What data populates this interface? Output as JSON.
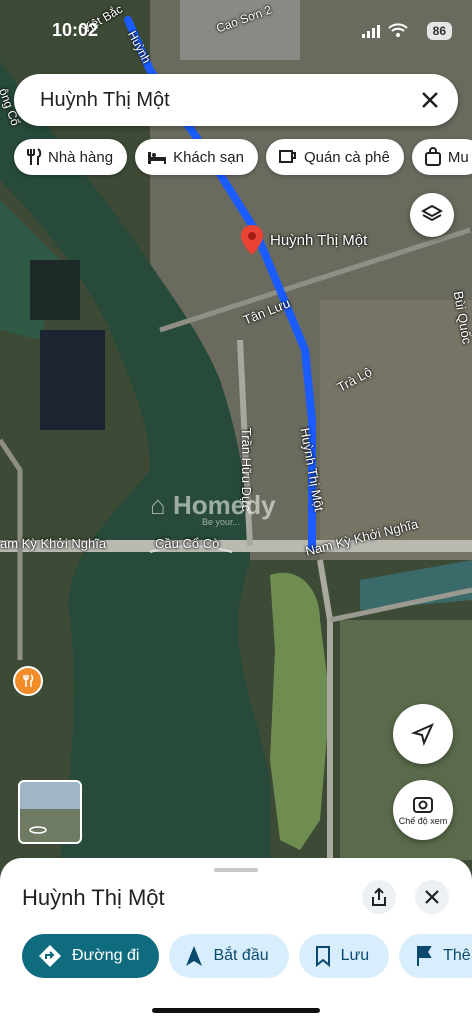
{
  "status": {
    "time": "10:02",
    "battery": "86"
  },
  "search": {
    "query": "Huỳnh Thị Một"
  },
  "chips": [
    {
      "label": "Nhà hàng",
      "icon": "fork-knife-icon"
    },
    {
      "label": "Khách sạn",
      "icon": "bed-icon"
    },
    {
      "label": "Quán cà phê",
      "icon": "coffee-icon"
    },
    {
      "label": "Mu",
      "icon": "shopping-bag-icon"
    }
  ],
  "map": {
    "pin_label": "Huỳnh Thị Một",
    "streets": {
      "viet_bac": "Việt Bắc",
      "huynh_top": "Huỳnh",
      "cao_son": "Cao Sơn 2",
      "tan_luu": "Tân Lưu",
      "tra_lo": "Trà Lộ",
      "bui_quoc": "Bùi Quốc",
      "tran_huu_duc": "Trần Hữu Dực",
      "huynh_thi_mot": "Huỳnh Thị Một",
      "nam_ky_left": "am Kỳ Khởi Nghĩa",
      "cau_co_co": "Cầu Cổ Cò",
      "nam_ky_right": "Nam Kỳ Khởi Nghĩa",
      "song_co": "ông Cổ"
    },
    "watermark": "Homedy",
    "watermark_sub": "Be your..."
  },
  "buttons": {
    "view_mode": "Chế độ xem"
  },
  "sheet": {
    "title": "Huỳnh Thị Một",
    "actions": [
      {
        "label": "Đường đi",
        "icon": "directions-icon"
      },
      {
        "label": "Bắt đầu",
        "icon": "navigation-arrow-icon"
      },
      {
        "label": "Lưu",
        "icon": "bookmark-icon"
      },
      {
        "label": "Thê",
        "icon": "flag-icon"
      }
    ]
  },
  "colors": {
    "route": "#1a5cff",
    "primary_action": "#0e6c7e",
    "secondary_action": "#d9eefc",
    "pin": "#ea4335"
  }
}
